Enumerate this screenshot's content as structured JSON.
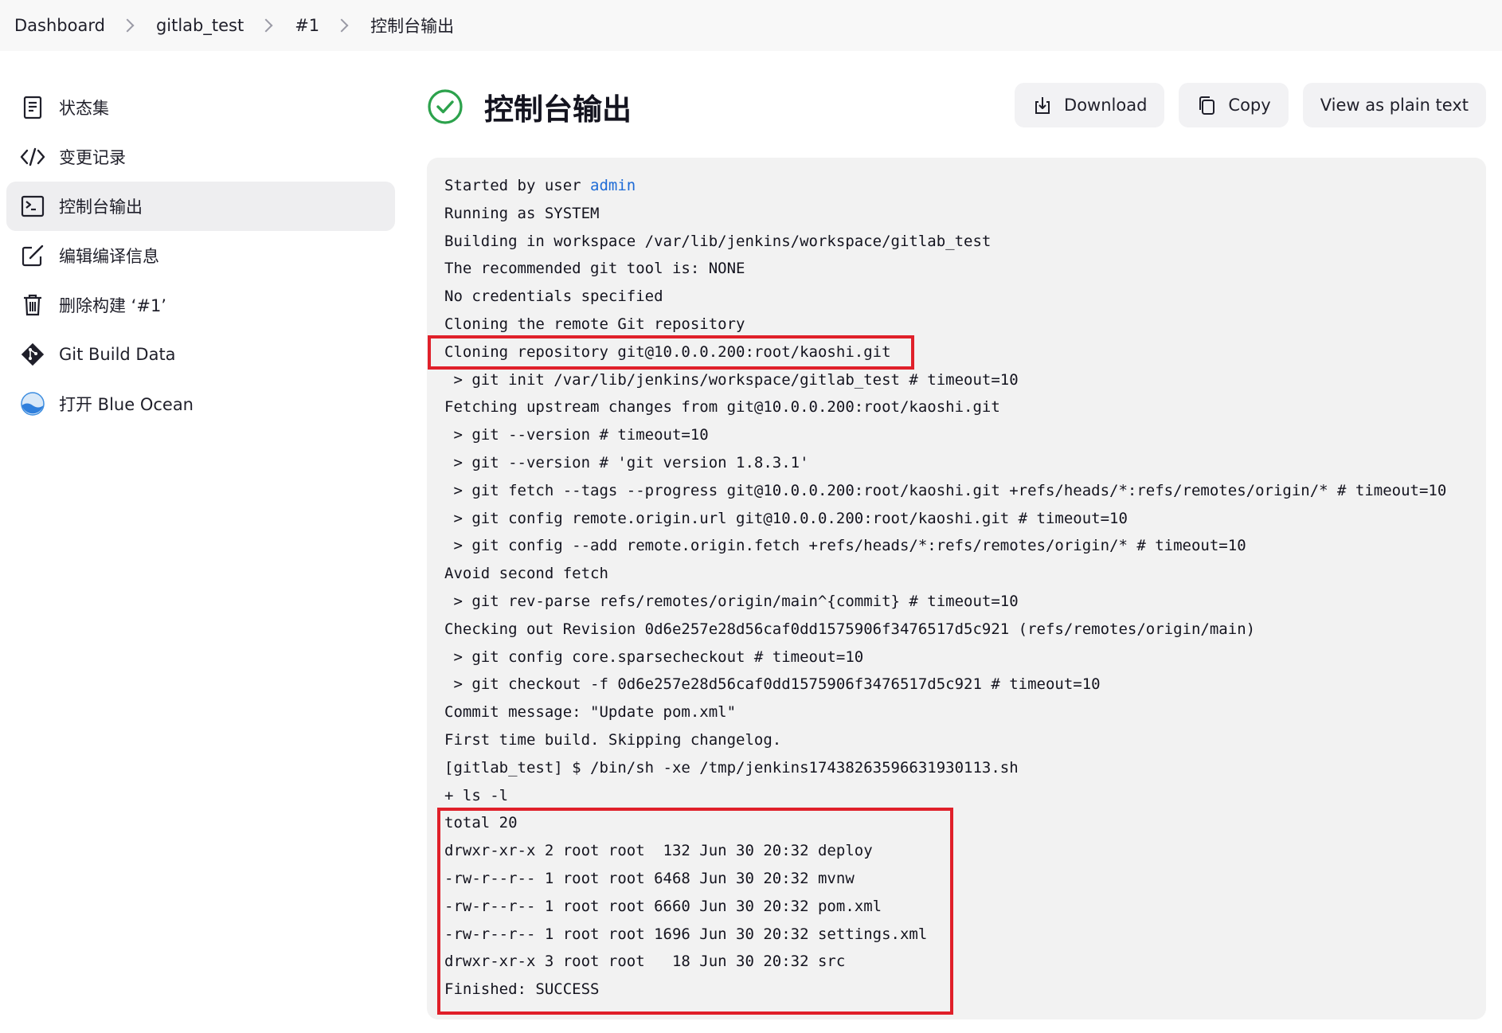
{
  "breadcrumb": {
    "items": [
      "Dashboard",
      "gitlab_test",
      "#1",
      "控制台输出"
    ]
  },
  "sidebar": {
    "items": [
      {
        "label": "状态集",
        "icon": "notepad-icon"
      },
      {
        "label": "变更记录",
        "icon": "code-icon"
      },
      {
        "label": "控制台输出",
        "icon": "terminal-icon"
      },
      {
        "label": "编辑编译信息",
        "icon": "edit-icon"
      },
      {
        "label": "删除构建 ‘#1’",
        "icon": "trash-icon"
      },
      {
        "label": "Git Build Data",
        "icon": "git-icon"
      },
      {
        "label": "打开 Blue Ocean",
        "icon": "blue-ocean-icon"
      }
    ],
    "active_index": 2
  },
  "header": {
    "title": "控制台输出",
    "status": "success",
    "buttons": {
      "download": "Download",
      "copy": "Copy",
      "plain_text": "View as plain text"
    }
  },
  "console": {
    "started_prefix": "Started by user ",
    "started_user": "admin",
    "lines": [
      "Running as SYSTEM",
      "Building in workspace /var/lib/jenkins/workspace/gitlab_test",
      "The recommended git tool is: NONE",
      "No credentials specified",
      "Cloning the remote Git repository",
      "Cloning repository git@10.0.0.200:root/kaoshi.git",
      " > git init /var/lib/jenkins/workspace/gitlab_test # timeout=10",
      "Fetching upstream changes from git@10.0.0.200:root/kaoshi.git",
      " > git --version # timeout=10",
      " > git --version # 'git version 1.8.3.1'",
      " > git fetch --tags --progress git@10.0.0.200:root/kaoshi.git +refs/heads/*:refs/remotes/origin/* # timeout=10",
      " > git config remote.origin.url git@10.0.0.200:root/kaoshi.git # timeout=10",
      " > git config --add remote.origin.fetch +refs/heads/*:refs/remotes/origin/* # timeout=10",
      "Avoid second fetch",
      " > git rev-parse refs/remotes/origin/main^{commit} # timeout=10",
      "Checking out Revision 0d6e257e28d56caf0dd1575906f3476517d5c921 (refs/remotes/origin/main)",
      " > git config core.sparsecheckout # timeout=10",
      " > git checkout -f 0d6e257e28d56caf0dd1575906f3476517d5c921 # timeout=10",
      "Commit message: \"Update pom.xml\"",
      "First time build. Skipping changelog.",
      "[gitlab_test] $ /bin/sh -xe /tmp/jenkins17438263596631930113.sh",
      "+ ls -l",
      "total 20",
      "drwxr-xr-x 2 root root  132 Jun 30 20:32 deploy",
      "-rw-r--r-- 1 root root 6468 Jun 30 20:32 mvnw",
      "-rw-r--r-- 1 root root 6660 Jun 30 20:32 pom.xml",
      "-rw-r--r-- 1 root root 1696 Jun 30 20:32 settings.xml",
      "drwxr-xr-x 3 root root   18 Jun 30 20:32 src",
      "Finished: SUCCESS"
    ]
  },
  "colors": {
    "success": "#2ca24c",
    "link": "#1e6bd6",
    "highlight": "#e0202a"
  }
}
